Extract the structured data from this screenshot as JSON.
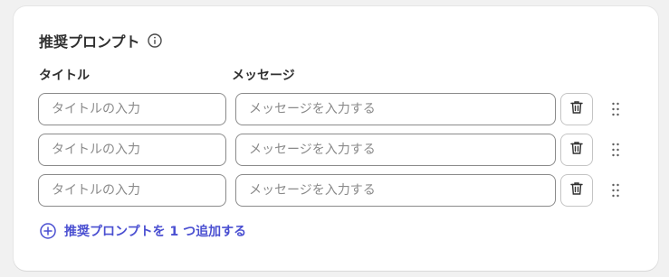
{
  "section": {
    "title": "推奨プロンプト",
    "info_icon": "info-icon"
  },
  "columns": {
    "title_label": "タイトル",
    "message_label": "メッセージ"
  },
  "rows": [
    {
      "title_value": "",
      "title_placeholder": "タイトルの入力",
      "message_value": "",
      "message_placeholder": "メッセージを入力する",
      "delete_icon": "trash-icon",
      "drag_icon": "drag-handle-icon"
    },
    {
      "title_value": "",
      "title_placeholder": "タイトルの入力",
      "message_value": "",
      "message_placeholder": "メッセージを入力する",
      "delete_icon": "trash-icon",
      "drag_icon": "drag-handle-icon"
    },
    {
      "title_value": "",
      "title_placeholder": "タイトルの入力",
      "message_value": "",
      "message_placeholder": "メッセージを入力する",
      "delete_icon": "trash-icon",
      "drag_icon": "drag-handle-icon"
    }
  ],
  "add_action": {
    "label": "推奨プロンプトを 1 つ追加する",
    "icon": "plus-circle-icon"
  },
  "colors": {
    "accent": "#4a4fd1",
    "text": "#303030",
    "placeholder": "#8a8a8a",
    "page_background": "#f1f1f1",
    "card_background": "#ffffff"
  }
}
